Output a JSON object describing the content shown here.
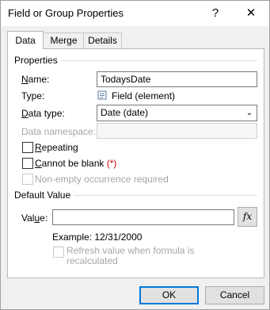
{
  "window": {
    "title": "Field or Group Properties",
    "help_label": "?",
    "close_label": "✕"
  },
  "tabs": [
    {
      "label": "Data",
      "active": true
    },
    {
      "label": "Merge",
      "active": false
    },
    {
      "label": "Details",
      "active": false
    }
  ],
  "properties": {
    "section_title": "Properties",
    "name_label_pre": "",
    "name_label_u": "N",
    "name_label_post": "ame:",
    "name_value": "TodaysDate",
    "type_label": "Type:",
    "type_icon": "field-element-icon",
    "type_value": "Field (element)",
    "data_type_label_u": "D",
    "data_type_label_post": "ata type:",
    "data_type_value": "Date (date)",
    "namespace_label": "Data namespace:",
    "namespace_value": "",
    "repeating_label_u": "R",
    "repeating_label_post": "epeating",
    "repeating_checked": false,
    "cannot_blank_label_u": "C",
    "cannot_blank_label_post": "annot be blank",
    "cannot_blank_suffix": "(*)",
    "cannot_blank_checked": false,
    "nonempty_label": "Non-empty occurrence required",
    "nonempty_checked": false
  },
  "default_value": {
    "section_title": "Default Value",
    "value_label_pre": "Val",
    "value_label_u": "u",
    "value_label_post": "e:",
    "value": "",
    "fx_label": "fx",
    "example_text": "Example: 12/31/2000",
    "refresh_label_line1": "Refresh value when formula is",
    "refresh_label_line2": "recalculated",
    "refresh_checked": false
  },
  "buttons": {
    "ok": "OK",
    "cancel": "Cancel"
  },
  "colors": {
    "default_button_border": "#0078d7",
    "required_marker": "#d00000"
  }
}
